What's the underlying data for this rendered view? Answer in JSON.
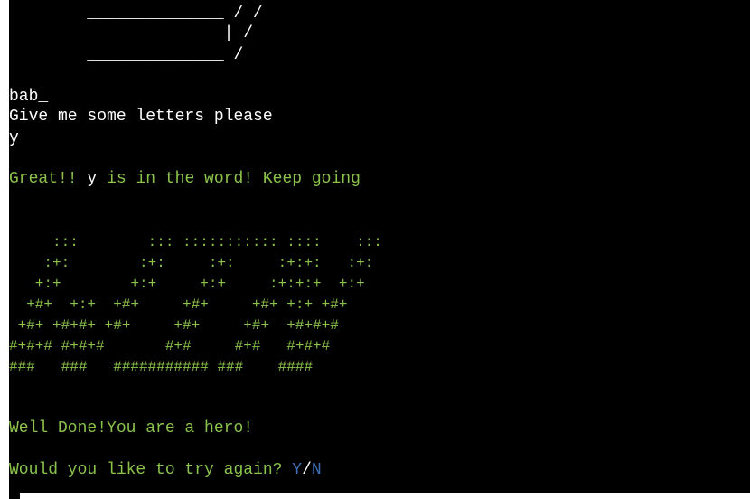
{
  "colors": {
    "background": "#000000",
    "text": "#ffffff",
    "success": "#8bc34a",
    "choice": "#3f6fb4"
  },
  "hangman": {
    "lines": [
      "        ______________ / /",
      "                      | /",
      "        ______________ /"
    ]
  },
  "game": {
    "word_progress": "bab_",
    "prompt": "Give me some letters please",
    "input": "y",
    "feedback_prefix": "Great!! ",
    "feedback_letter": "y",
    "feedback_suffix": " is in the word! Keep going"
  },
  "win_banner": {
    "lines": [
      "     :::        ::: ::::::::::: ::::    :::",
      "    :+:        :+:     :+:     :+:+:   :+:",
      "   +:+        +:+     +:+     :+:+:+  +:+",
      "  +#+  +:+  +#+     +#+     +#+ +:+ +#+",
      " +#+ +#+#+ +#+     +#+     +#+  +#+#+#",
      "#+#+# #+#+#       #+#     #+#   #+#+#",
      "###   ###   ########### ###    ####"
    ]
  },
  "result": {
    "message": "Well Done!You are a hero!",
    "replay_question": "Would you like to try again? ",
    "yes_option": "Y",
    "separator": "/",
    "no_option": "N"
  }
}
